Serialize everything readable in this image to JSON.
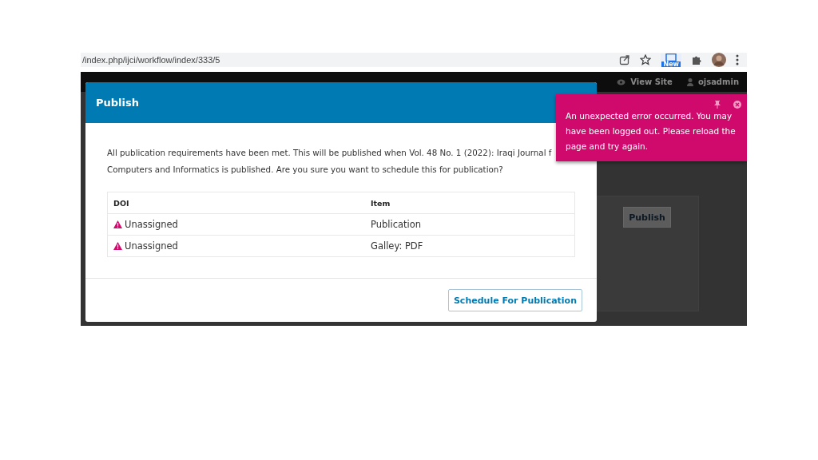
{
  "browser": {
    "url": "/index.php/ijci/workflow/index/333/5",
    "extension_badge": "New"
  },
  "navbar": {
    "right": [
      {
        "kind": "eye",
        "label": "View Site"
      },
      {
        "kind": "user",
        "label": "ojsadmin"
      }
    ]
  },
  "background": {
    "button": "Publish"
  },
  "modal": {
    "title": "Publish",
    "message_lines": [
      "All publication requirements have been met. This will be published when Vol. 48 No. 1 (2022): Iraqi Journal f",
      "Computers and Informatics is published. Are you sure you want to schedule this for publication?"
    ],
    "table": {
      "columns": [
        "DOI",
        "Item"
      ],
      "rows": [
        {
          "doi": "Unassigned",
          "warning": true,
          "item": "Publication"
        },
        {
          "doi": "Unassigned",
          "warning": true,
          "item": "Galley: PDF"
        }
      ]
    },
    "button": "Schedule For Publication"
  },
  "toast": {
    "message": "An unexpected error occurred. You may have been logged out. Please reload the page and try again."
  }
}
